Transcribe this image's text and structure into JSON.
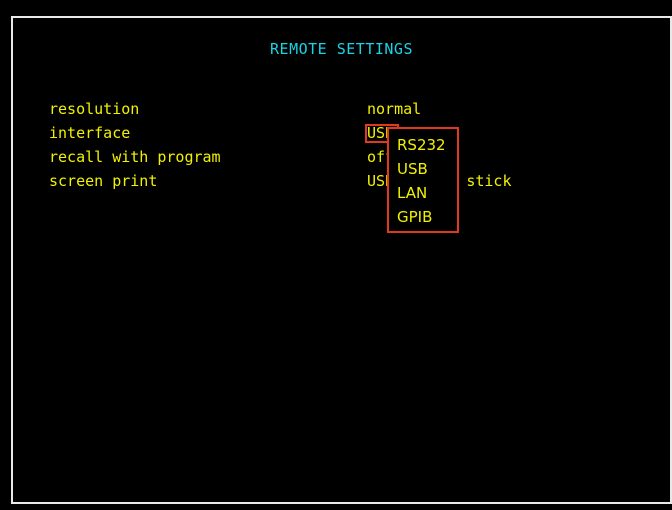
{
  "colors": {
    "background": "#000000",
    "title": "#19d3e6",
    "text": "#f2f200",
    "highlight": "#e03a1e",
    "border": "#e8e8e8"
  },
  "header": {
    "title": "REMOTE SETTINGS"
  },
  "settings": [
    {
      "label": "resolution",
      "value": "normal"
    },
    {
      "label": "interface",
      "value": "USB"
    },
    {
      "label": "recall with program",
      "value": "off"
    },
    {
      "label": "screen print",
      "value": "USB memory stick"
    }
  ],
  "interface_dropdown": {
    "options": [
      "RS232",
      "USB",
      "LAN",
      "GPIB"
    ]
  }
}
